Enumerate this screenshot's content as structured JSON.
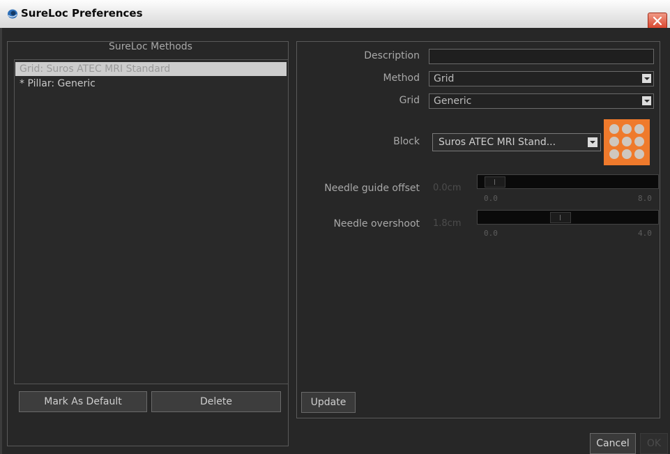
{
  "window": {
    "title": "SureLoc Preferences"
  },
  "methods": {
    "heading": "SureLoc Methods",
    "items": [
      {
        "label": "Grid: Suros ATEC MRI Standard"
      },
      {
        "label": "* Pillar: Generic"
      }
    ],
    "mark_default_label": "Mark As Default",
    "delete_label": "Delete"
  },
  "form": {
    "description_label": "Description",
    "description_value": "",
    "method_label": "Method",
    "method_value": "Grid",
    "grid_label": "Grid",
    "grid_value": "Generic",
    "block_label": "Block",
    "block_value": "Suros ATEC MRI Stand...",
    "needle_guide": {
      "label": "Needle guide offset",
      "value_text": "0.0cm",
      "min": "0.0",
      "max": "8.0",
      "value": 0.0
    },
    "needle_overshoot": {
      "label": "Needle overshoot",
      "value_text": "1.8cm",
      "min": "0.0",
      "max": "4.0",
      "value": 1.8
    },
    "update_label": "Update"
  },
  "footer": {
    "cancel_label": "Cancel",
    "ok_label": "OK"
  },
  "colors": {
    "accent_orange": "#ef7a2c",
    "close_red": "#d9432b"
  }
}
